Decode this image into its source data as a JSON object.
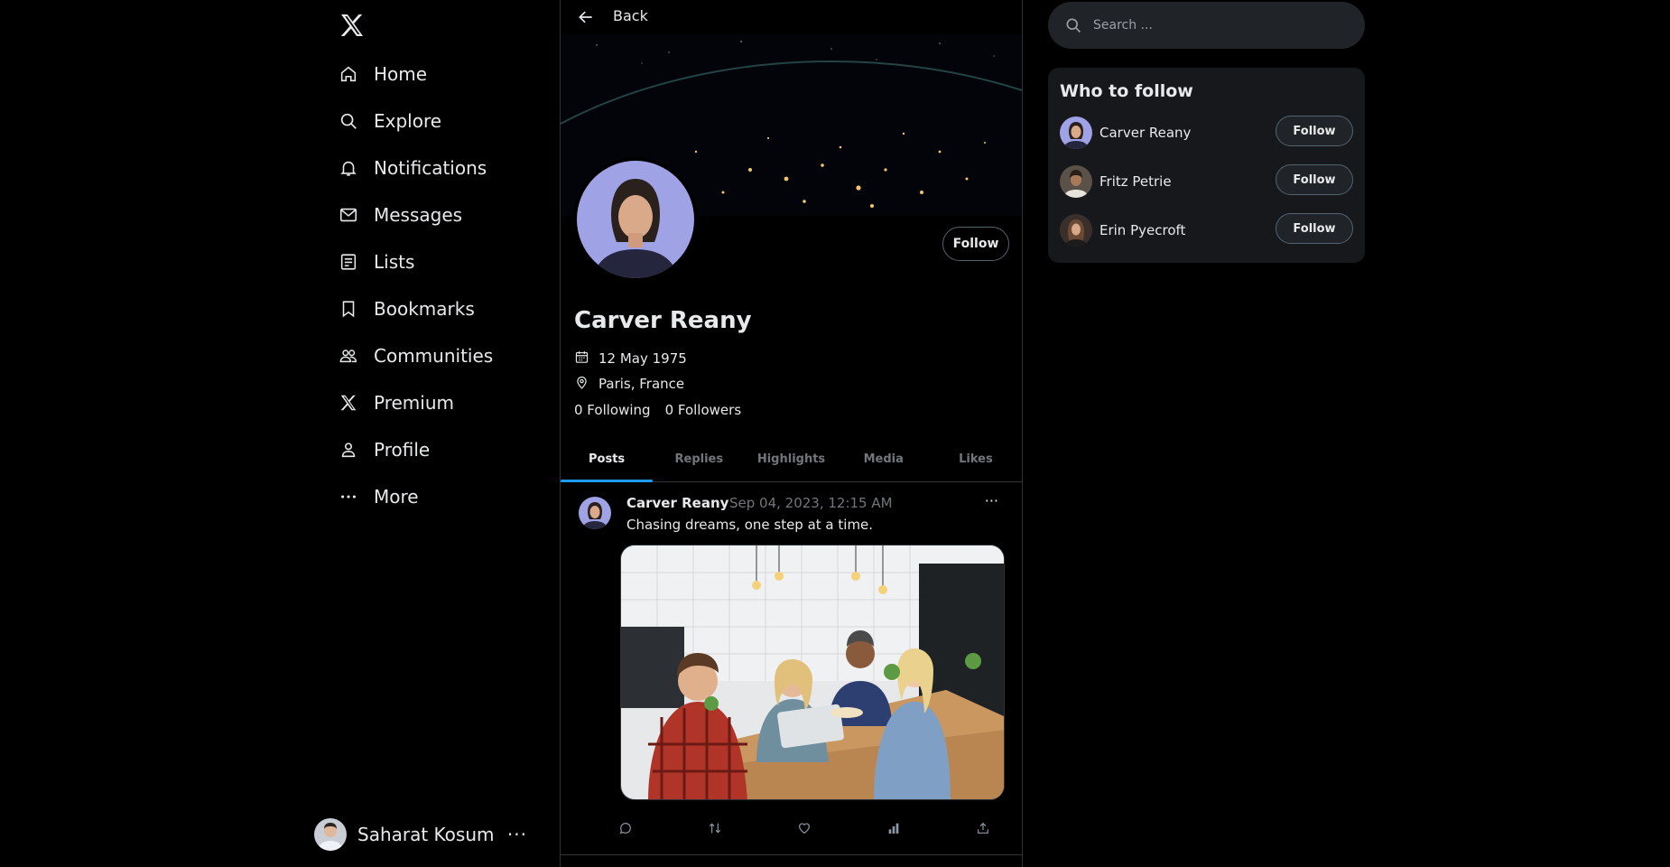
{
  "nav": {
    "logo_icon": "x-logo-icon",
    "items": [
      {
        "label": "Home",
        "icon": "home-icon"
      },
      {
        "label": "Explore",
        "icon": "search-icon"
      },
      {
        "label": "Notifications",
        "icon": "bell-icon"
      },
      {
        "label": "Messages",
        "icon": "envelope-icon"
      },
      {
        "label": "Lists",
        "icon": "list-icon"
      },
      {
        "label": "Bookmarks",
        "icon": "bookmark-icon"
      },
      {
        "label": "Communities",
        "icon": "people-icon"
      },
      {
        "label": "Premium",
        "icon": "x-logo-icon"
      },
      {
        "label": "Profile",
        "icon": "person-icon"
      },
      {
        "label": "More",
        "icon": "more-dots-icon"
      }
    ],
    "current_user": {
      "name": "Saharat Kosum",
      "more": "···"
    }
  },
  "main": {
    "back_label": "Back",
    "profile": {
      "name": "Carver Reany",
      "follow_label": "Follow",
      "birth_date": "12 May 1975",
      "location": "Paris, France",
      "following": "0 Following",
      "followers": "0 Followers"
    },
    "tabs": [
      {
        "label": "Posts",
        "active": true
      },
      {
        "label": "Replies",
        "active": false
      },
      {
        "label": "Highlights",
        "active": false
      },
      {
        "label": "Media",
        "active": false
      },
      {
        "label": "Likes",
        "active": false
      }
    ],
    "post": {
      "author": "Carver Reany",
      "date": "Sep 04, 2023, 12:15 AM",
      "more": "···",
      "text": "Chasing dreams, one step at a time."
    }
  },
  "right": {
    "search_placeholder": "Search ...",
    "who_to_follow": {
      "title": "Who to follow",
      "users": [
        {
          "name": "Carver Reany",
          "button": "Follow"
        },
        {
          "name": "Fritz Petrie",
          "button": "Follow"
        },
        {
          "name": "Erin Pyecroft",
          "button": "Follow"
        }
      ]
    }
  },
  "colors": {
    "accent": "#1d9bf0",
    "border": "#2f3336",
    "muted": "#71767b",
    "card": "#16181c"
  }
}
